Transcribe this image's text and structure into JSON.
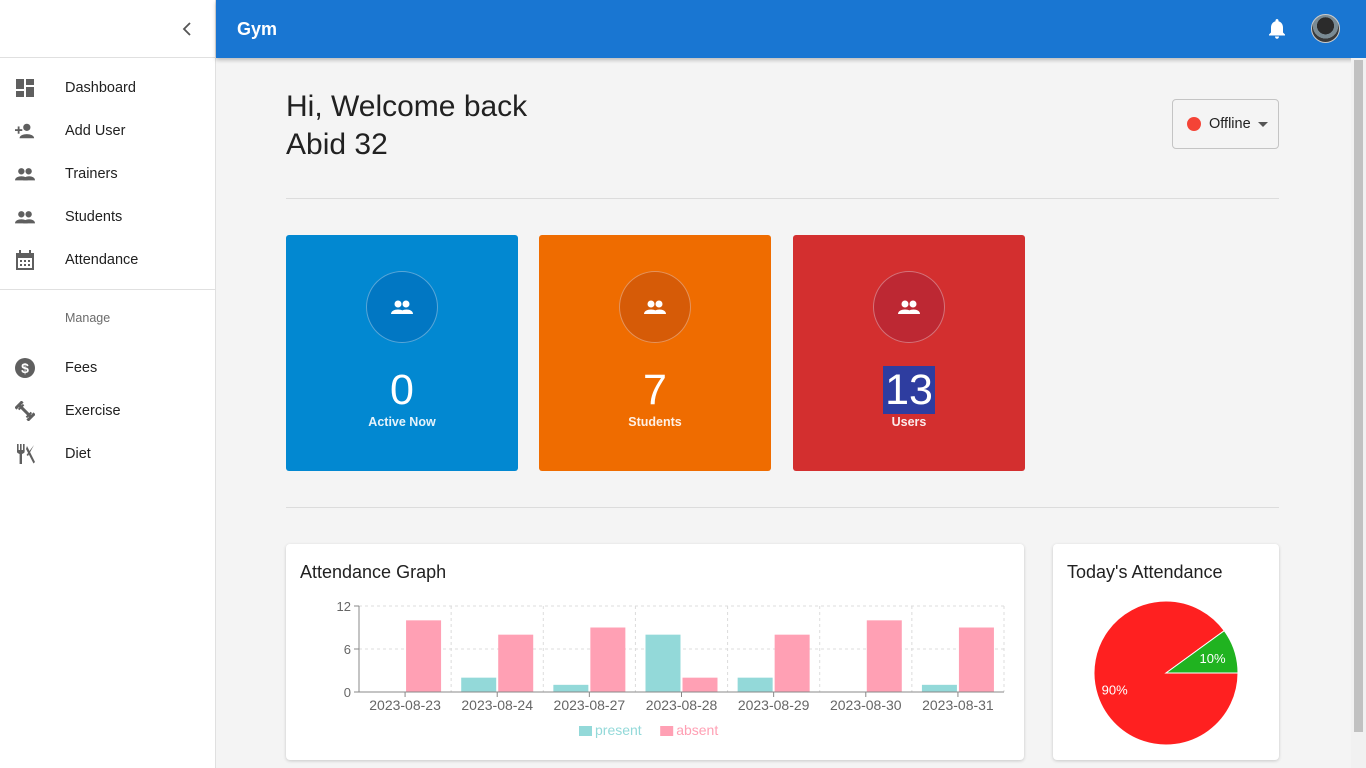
{
  "sidebar": {
    "items": [
      {
        "label": "Dashboard",
        "icon": "dashboard-icon"
      },
      {
        "label": "Add User",
        "icon": "person-add-icon"
      },
      {
        "label": "Trainers",
        "icon": "people-icon"
      },
      {
        "label": "Students",
        "icon": "people-icon"
      },
      {
        "label": "Attendance",
        "icon": "calendar-icon"
      }
    ],
    "section_label": "Manage",
    "manage_items": [
      {
        "label": "Fees",
        "icon": "dollar-icon"
      },
      {
        "label": "Exercise",
        "icon": "dumbbell-icon"
      },
      {
        "label": "Diet",
        "icon": "restaurant-icon"
      }
    ]
  },
  "appbar": {
    "title": "Gym"
  },
  "header": {
    "greeting": "Hi, Welcome back",
    "username": "Abid 32",
    "status": "Offline",
    "status_color": "#f44336"
  },
  "stats": [
    {
      "value": "0",
      "label": "Active Now",
      "color": "#0288d1"
    },
    {
      "value": "7",
      "label": "Students",
      "color": "#ef6c00"
    },
    {
      "value": "13",
      "label": "Users",
      "color": "#d32f2f"
    }
  ],
  "attendance_graph": {
    "title": "Attendance Graph"
  },
  "todays_attendance": {
    "title": "Today's Attendance"
  },
  "chart_data": [
    {
      "type": "bar",
      "title": "Attendance Graph",
      "categories": [
        "2023-08-23",
        "2023-08-24",
        "2023-08-27",
        "2023-08-28",
        "2023-08-29",
        "2023-08-30",
        "2023-08-31"
      ],
      "series": [
        {
          "name": "present",
          "values": [
            0,
            2,
            1,
            8,
            2,
            0,
            1
          ],
          "color": "#93d9d9"
        },
        {
          "name": "absent",
          "values": [
            10,
            8,
            9,
            2,
            8,
            10,
            9
          ],
          "color": "#ffa0b4"
        }
      ],
      "ylim": [
        0,
        12
      ],
      "yticks": [
        "0",
        "6",
        "12"
      ],
      "grid": true,
      "legend": "bottom"
    },
    {
      "type": "pie",
      "title": "Today's Attendance",
      "slices": [
        {
          "label": "90%",
          "value": 90,
          "color": "#ff2020"
        },
        {
          "label": "10%",
          "value": 10,
          "color": "#20b320"
        }
      ]
    }
  ]
}
